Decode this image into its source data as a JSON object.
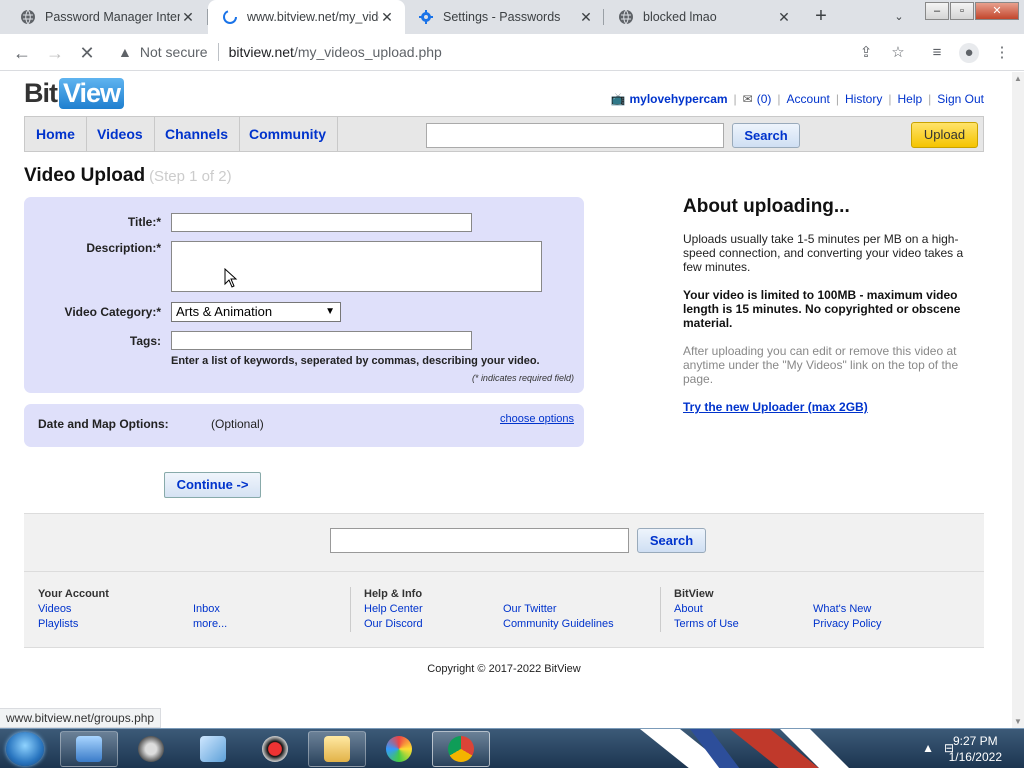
{
  "browser": {
    "tabs": [
      {
        "title": "Password Manager Interna",
        "active": false,
        "icon": "globe-icon"
      },
      {
        "title": "www.bitview.net/my_video",
        "active": true,
        "icon": "loading-icon"
      },
      {
        "title": "Settings - Passwords",
        "active": false,
        "icon": "gear-icon"
      },
      {
        "title": "blocked lmao",
        "active": false,
        "icon": "globe-icon"
      }
    ],
    "security_label": "Not secure",
    "url_host": "bitview.net",
    "url_path": "/my_videos_upload.php",
    "status_url": "www.bitview.net/groups.php"
  },
  "site": {
    "logo_bit": "Bit",
    "logo_view": "View",
    "username": "mylovehypercam",
    "inbox_count": "(0)",
    "user_links": [
      "Account",
      "History",
      "Help",
      "Sign Out"
    ],
    "nav": [
      "Home",
      "Videos",
      "Channels",
      "Community"
    ],
    "search_label": "Search",
    "upload_label": "Upload"
  },
  "upload": {
    "title": "Video Upload",
    "step": "(Step 1 of 2)",
    "title_label": "Title:*",
    "description_label": "Description:*",
    "category_label": "Video Category:*",
    "category_value": "Arts & Animation",
    "tags_label": "Tags:",
    "tags_hint": "Enter a list of keywords, seperated by commas, describing your video.",
    "required_hint": "(* indicates required field)",
    "date_label": "Date and Map Options:",
    "date_optional": "(Optional)",
    "choose_options": "choose options",
    "continue_label": "Continue ->"
  },
  "about": {
    "heading": "About uploading...",
    "p1": "Uploads usually take 1-5 minutes per MB on a high-speed connection, and converting your video takes a few minutes.",
    "p2": "Your video is limited to 100MB - maximum video length is 15 minutes. No copyrighted or obscene material.",
    "p3": "After uploading you can edit or remove this video at anytime under the \"My Videos\" link on the top of the page.",
    "link": "Try the new Uploader (max 2GB)"
  },
  "footer": {
    "search_label": "Search",
    "your_account": "Your Account",
    "help_info": "Help & Info",
    "bitview": "BitView",
    "links": {
      "videos": "Videos",
      "inbox": "Inbox",
      "playlists": "Playlists",
      "more": "more...",
      "help_center": "Help Center",
      "our_twitter": "Our Twitter",
      "our_discord": "Our Discord",
      "community_guidelines": "Community Guidelines",
      "about": "About",
      "whats_new": "What's New",
      "terms": "Terms of Use",
      "privacy": "Privacy Policy"
    },
    "copyright": "Copyright © 2017-2022 BitView"
  },
  "taskbar": {
    "time": "9:27 PM",
    "date": "1/16/2022"
  },
  "colors": {
    "link": "#0033cc",
    "form_bg": "#dfe0fa",
    "upload_button": "#f5c400"
  }
}
